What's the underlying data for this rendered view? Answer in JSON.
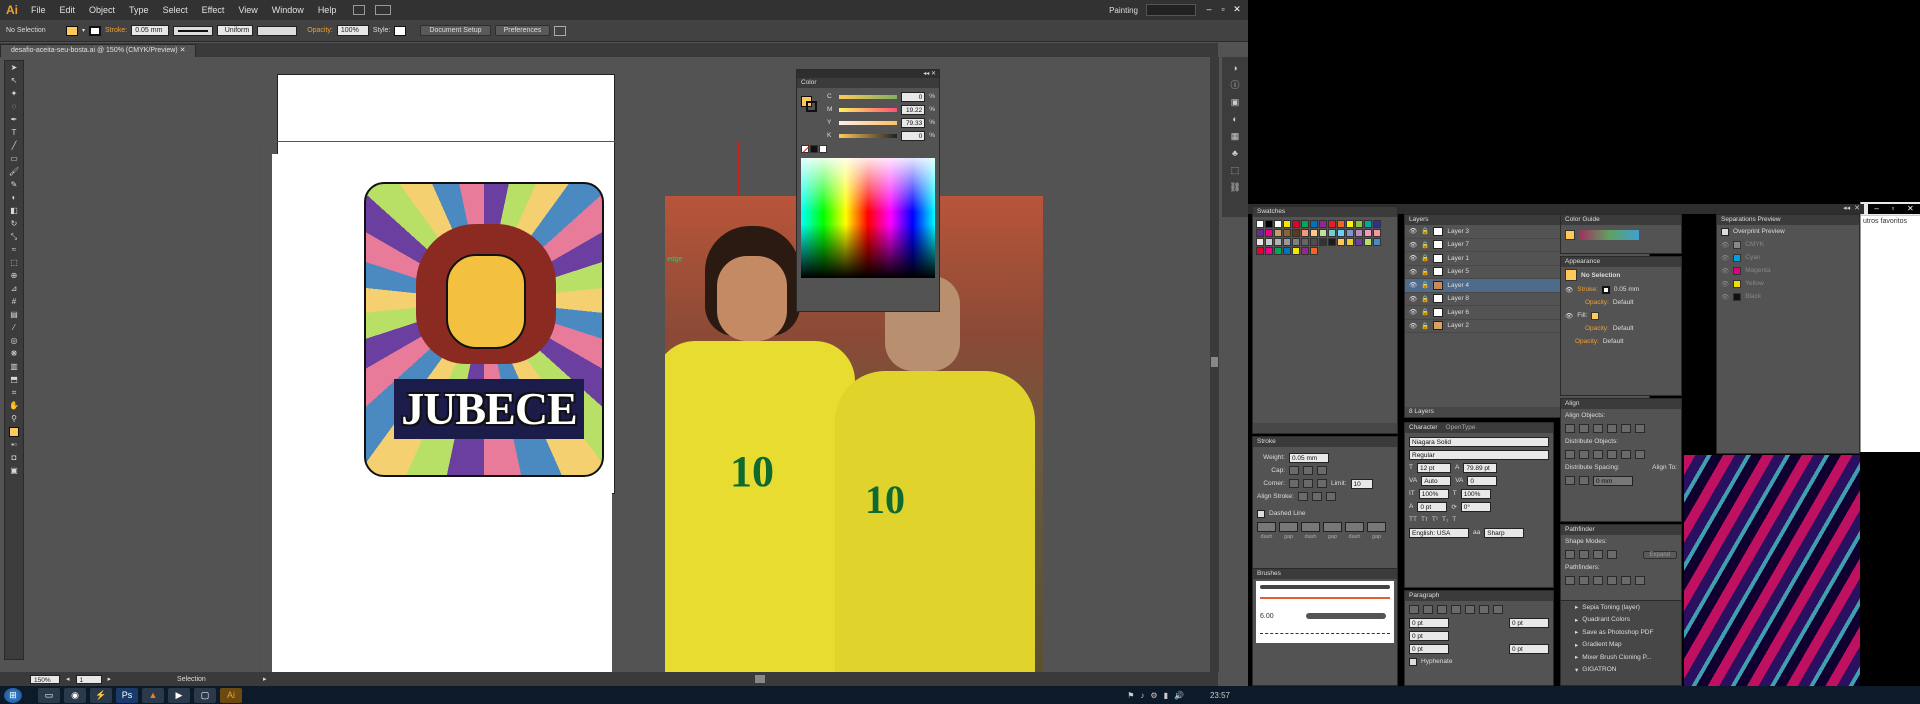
{
  "app": {
    "logo": "Ai",
    "workspace": "Painting"
  },
  "menu": [
    "File",
    "Edit",
    "Object",
    "Type",
    "Select",
    "Effect",
    "View",
    "Window",
    "Help"
  ],
  "control_bar": {
    "selection": "No Selection",
    "stroke_label": "Stroke:",
    "stroke_value": "0.05 mm",
    "profile": "Uniform",
    "opacity_label": "Opacity:",
    "opacity_value": "100%",
    "style_label": "Style:",
    "doc_setup": "Document Setup",
    "preferences": "Preferences"
  },
  "document_tab": "desafio-aceita-seu-bosta.ai @ 150% (CMYK/Preview)",
  "artwork": {
    "title_text": "JUBECE",
    "edge_label": "edge",
    "jersey_number": "10"
  },
  "color_panel": {
    "title": "Color",
    "channels": [
      {
        "label": "C",
        "value": "0",
        "unit": "%"
      },
      {
        "label": "M",
        "value": "19.22",
        "unit": "%"
      },
      {
        "label": "Y",
        "value": "79.33",
        "unit": "%"
      },
      {
        "label": "K",
        "value": "0",
        "unit": "%"
      }
    ]
  },
  "swatches": {
    "title": "Swatches"
  },
  "stroke_panel": {
    "title": "Stroke",
    "weight_label": "Weight:",
    "weight_value": "0.05 mm",
    "cap_label": "Cap:",
    "corner_label": "Corner:",
    "limit_label": "Limit:",
    "limit_value": "10",
    "align_label": "Align Stroke:",
    "dashed_label": "Dashed Line",
    "dash_labels": [
      "dash",
      "gap",
      "dash",
      "gap",
      "dash",
      "gap"
    ]
  },
  "brushes": {
    "title": "Brushes",
    "size": "6.00"
  },
  "layers": {
    "title": "Layers",
    "items": [
      "Layer 3",
      "Layer 7",
      "Layer 1",
      "Layer 5",
      "Layer 4",
      "Layer 8",
      "Layer 6",
      "Layer 2"
    ],
    "count": "8 Layers"
  },
  "character": {
    "tabs": [
      "Character",
      "OpenType"
    ],
    "font": "Niagara Solid",
    "style": "Regular",
    "size": "12 pt",
    "leading": "79.89 pt",
    "kerning": "Auto",
    "tracking": "0",
    "hscale": "100%",
    "vscale": "100%",
    "baseline": "0 pt",
    "rotation": "0°",
    "language": "English: USA",
    "aa": "Sharp"
  },
  "paragraph": {
    "title": "Paragraph",
    "values": [
      "0 pt",
      "0 pt",
      "0 pt",
      "0 pt",
      "0 pt"
    ],
    "hyphenate": "Hyphenate"
  },
  "color_guide": {
    "title": "Color Guide"
  },
  "appearance": {
    "title": "Appearance",
    "no_selection": "No Selection",
    "stroke_label": "Stroke:",
    "stroke_value": "0.05 mm",
    "opacity_label": "Opacity:",
    "opacity_value": "Default",
    "fill_label": "Fill:"
  },
  "align": {
    "title": "Align",
    "align_objects": "Align Objects:",
    "distribute_objects": "Distribute Objects:",
    "distribute_spacing": "Distribute Spacing:",
    "align_to": "Align To:",
    "spacing_value": "0 mm"
  },
  "pathfinder": {
    "title": "Pathfinder",
    "shape_modes": "Shape Modes:",
    "expand": "Expand",
    "pathfinders": "Pathfinders:"
  },
  "actions": [
    "Sepia Toning (layer)",
    "Quadrant Colors",
    "Save as Photoshop PDF",
    "Gradient Map",
    "Mixer Brush Cloning P...",
    "GIGATRON"
  ],
  "separations": {
    "title": "Separations Preview",
    "overprint": "Overprint Preview",
    "inks": [
      "CMYK",
      "Cyan",
      "Magenta",
      "Yellow",
      "Black"
    ],
    "ink_colors": [
      "#888888",
      "#00a0e0",
      "#e0007a",
      "#f0e000",
      "#111111"
    ]
  },
  "browser": {
    "favorites": "utros favoritos"
  },
  "status": {
    "zoom": "150%",
    "page": "1",
    "tool": "Selection"
  },
  "taskbar": {
    "time": "23:57"
  },
  "colors": {
    "accent": "#f0a030",
    "selected_fill": "#ffc95a"
  }
}
